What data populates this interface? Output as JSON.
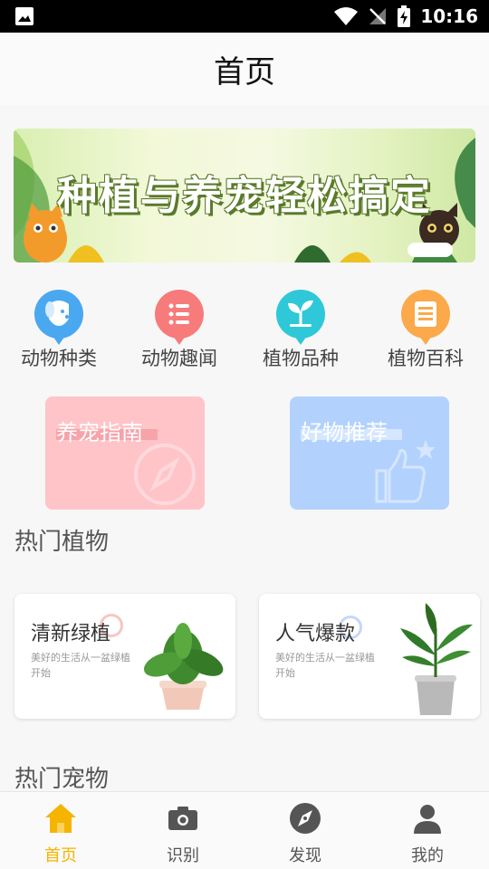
{
  "status_bar": {
    "time": "10:16"
  },
  "header": {
    "title": "首页"
  },
  "banner": {
    "text": "种植与养宠轻松搞定"
  },
  "categories": [
    {
      "label": "动物种类",
      "icon": "dog-icon",
      "color": "#4aa8f0"
    },
    {
      "label": "动物趣闻",
      "icon": "list-icon",
      "color": "#f77b7b"
    },
    {
      "label": "植物品种",
      "icon": "sprout-icon",
      "color": "#2fc8d8"
    },
    {
      "label": "植物百科",
      "icon": "book-icon",
      "color": "#fba94a"
    }
  ],
  "feature_cards": [
    {
      "label": "养宠指南",
      "icon": "compass-icon",
      "color": "#ffc4c8"
    },
    {
      "label": "好物推荐",
      "icon": "thumbs-up-icon",
      "color": "#b2d2fd"
    }
  ],
  "sections": {
    "hot_plants": "热门植物",
    "hot_pets": "热门宠物"
  },
  "plant_cards": [
    {
      "title": "清新绿植",
      "desc": "美好的生活从一盆绿植开始",
      "accent": "#f7b3b3"
    },
    {
      "title": "人气爆款",
      "desc": "美好的生活从一盆绿植开始",
      "accent": "#b8cff7"
    }
  ],
  "bottom_nav": [
    {
      "label": "首页",
      "icon": "home-icon",
      "active": true
    },
    {
      "label": "识别",
      "icon": "camera-icon",
      "active": false
    },
    {
      "label": "发现",
      "icon": "compass-icon",
      "active": false
    },
    {
      "label": "我的",
      "icon": "person-icon",
      "active": false
    }
  ],
  "colors": {
    "active": "#f5b400",
    "inactive_icon": "#555555"
  }
}
